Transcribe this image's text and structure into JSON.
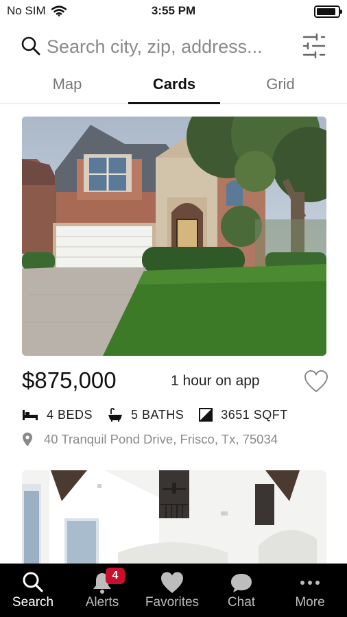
{
  "status_bar": {
    "carrier": "No SIM",
    "time": "3:55 PM",
    "battery_level": 0.9
  },
  "search": {
    "placeholder": "Search city, zip, address..."
  },
  "tabs": [
    {
      "label": "Map",
      "active": false
    },
    {
      "label": "Cards",
      "active": true
    },
    {
      "label": "Grid",
      "active": false
    }
  ],
  "listing": {
    "price": "$875,000",
    "time_on_app": "1 hour on app",
    "beds": "4 BEDS",
    "baths": "5 BATHS",
    "sqft": "3651 SQFT",
    "address": "40 Tranquil Pond Drive, Frisco, Tx, 75034"
  },
  "bottom_nav": [
    {
      "label": "Search",
      "icon": "search-icon",
      "active": true
    },
    {
      "label": "Alerts",
      "icon": "bell-icon",
      "badge": "4"
    },
    {
      "label": "Favorites",
      "icon": "heart-icon"
    },
    {
      "label": "Chat",
      "icon": "chat-icon"
    },
    {
      "label": "More",
      "icon": "more-icon"
    }
  ],
  "colors": {
    "accent": "#111111",
    "badge": "#c8102e",
    "nav_bg": "#000000"
  }
}
